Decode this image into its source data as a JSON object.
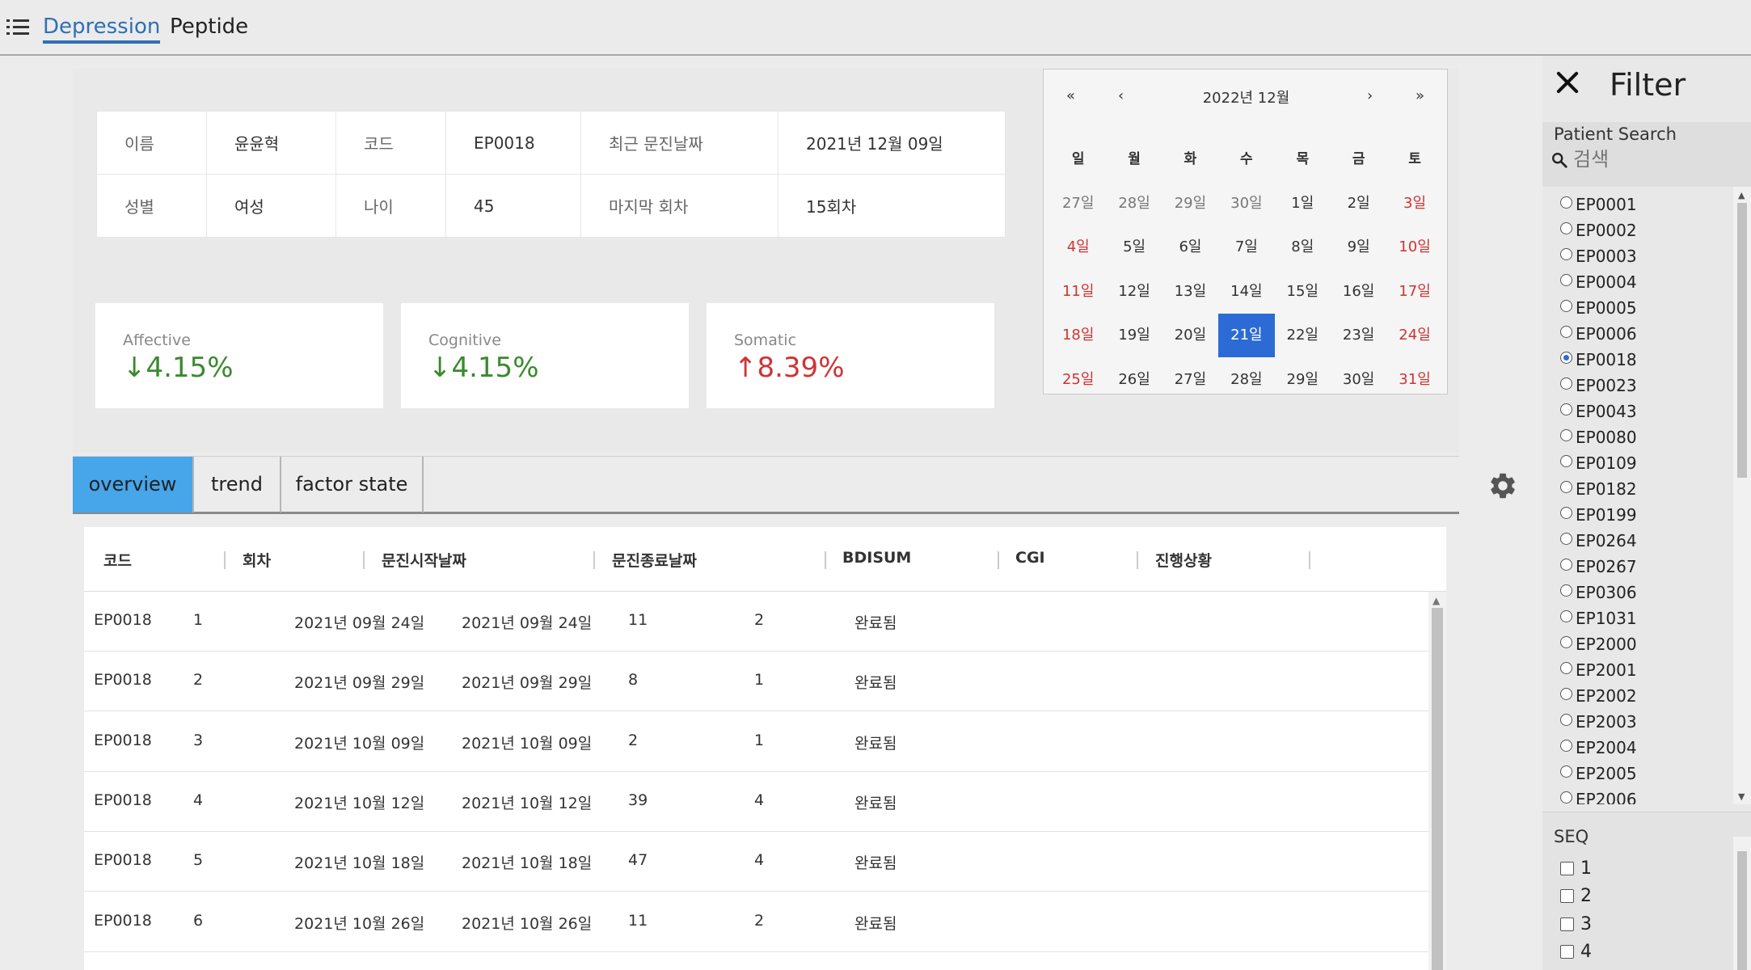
{
  "nav": {
    "items": [
      {
        "label": "Depression",
        "active": true
      },
      {
        "label": "Peptide",
        "active": false
      }
    ]
  },
  "patient_info": {
    "row1": [
      "이름",
      "윤윤혁",
      "코드",
      "EP0018",
      "최근 문진날짜",
      "2021년 12월 09일"
    ],
    "row2": [
      "성별",
      "여성",
      "나이",
      "45",
      "마지막 회차",
      "15회차"
    ]
  },
  "factor_cards": [
    {
      "title": "Affective",
      "value": "↓4.15%",
      "trend": "down",
      "color": "#3a8a2f"
    },
    {
      "title": "Cognitive",
      "value": "↓4.15%",
      "trend": "down",
      "color": "#3a8a2f"
    },
    {
      "title": "Somatic",
      "value": "↑8.39%",
      "trend": "up",
      "color": "#cf3434"
    }
  ],
  "calendar": {
    "title": "2022년 12월",
    "nav": {
      "prev_year": "«",
      "prev_month": "‹",
      "next_month": "›",
      "next_year": "»"
    },
    "weekdays": [
      "일",
      "월",
      "화",
      "수",
      "목",
      "금",
      "토"
    ],
    "weeks": [
      [
        "27일",
        "28일",
        "29일",
        "30일",
        "1일",
        "2일",
        "3일"
      ],
      [
        "4일",
        "5일",
        "6일",
        "7일",
        "8일",
        "9일",
        "10일"
      ],
      [
        "11일",
        "12일",
        "13일",
        "14일",
        "15일",
        "16일",
        "17일"
      ],
      [
        "18일",
        "19일",
        "20일",
        "21일",
        "22일",
        "23일",
        "24일"
      ],
      [
        "25일",
        "26일",
        "27일",
        "28일",
        "29일",
        "30일",
        "31일"
      ]
    ],
    "selected": "21일",
    "accent": "#2c6bd6"
  },
  "tabs": [
    {
      "label": "overview",
      "active": true
    },
    {
      "label": "trend",
      "active": false
    },
    {
      "label": "factor state",
      "active": false
    }
  ],
  "settings_icon": "gear-icon",
  "table": {
    "columns": [
      "코드",
      "회차",
      "문진시작날짜",
      "문진종료날짜",
      "BDISUM",
      "CGI",
      "진행상황"
    ],
    "rows": [
      [
        "EP0018",
        "1",
        "2021년 09월 24일",
        "2021년 09월 24일",
        "11",
        "2",
        "완료됨"
      ],
      [
        "EP0018",
        "2",
        "2021년 09월 29일",
        "2021년 09월 29일",
        "8",
        "1",
        "완료됨"
      ],
      [
        "EP0018",
        "3",
        "2021년 10월 09일",
        "2021년 10월 09일",
        "2",
        "1",
        "완료됨"
      ],
      [
        "EP0018",
        "4",
        "2021년 10월 12일",
        "2021년 10월 12일",
        "39",
        "4",
        "완료됨"
      ],
      [
        "EP0018",
        "5",
        "2021년 10월 18일",
        "2021년 10월 18일",
        "47",
        "4",
        "완료됨"
      ],
      [
        "EP0018",
        "6",
        "2021년 10월 26일",
        "2021년 10월 26일",
        "11",
        "2",
        "완료됨"
      ]
    ]
  },
  "filter": {
    "title": "Filter",
    "search_label": "Patient Search",
    "search_placeholder": "검색",
    "patients": [
      "EP0001",
      "EP0002",
      "EP0003",
      "EP0004",
      "EP0005",
      "EP0006",
      "EP0018",
      "EP0023",
      "EP0043",
      "EP0080",
      "EP0109",
      "EP0182",
      "EP0199",
      "EP0264",
      "EP0267",
      "EP0306",
      "EP1031",
      "EP2000",
      "EP2001",
      "EP2002",
      "EP2003",
      "EP2004",
      "EP2005",
      "EP2006"
    ],
    "selected_patient": "EP0018",
    "seq_title": "SEQ",
    "seq_options": [
      "1",
      "2",
      "3",
      "4"
    ]
  }
}
